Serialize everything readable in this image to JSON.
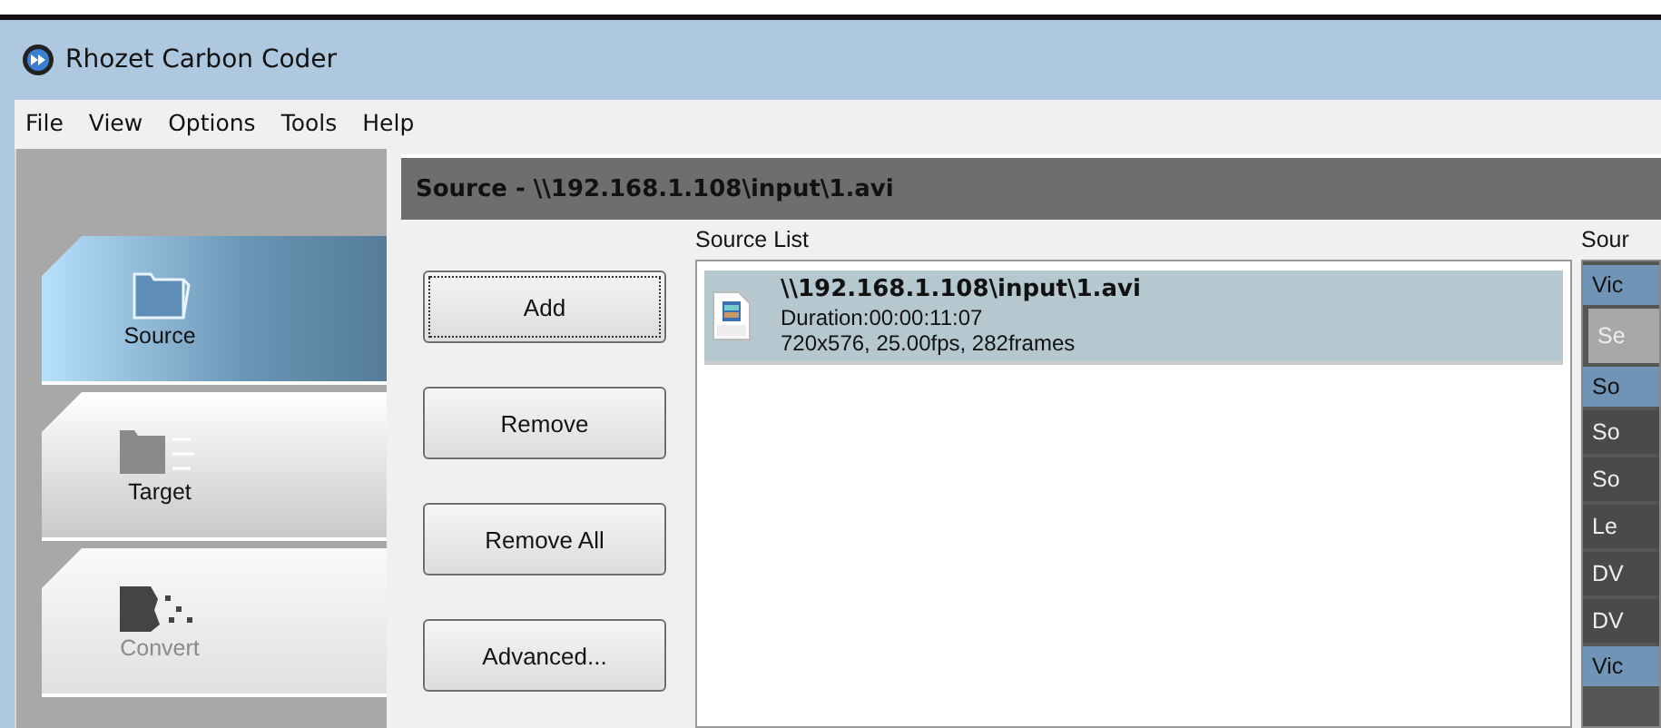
{
  "window": {
    "title": "Rhozet Carbon Coder"
  },
  "menu": [
    {
      "label": "File"
    },
    {
      "label": "View"
    },
    {
      "label": "Options"
    },
    {
      "label": "Tools"
    },
    {
      "label": "Help"
    }
  ],
  "sidebar": {
    "items": [
      {
        "label": "Source",
        "selected": true,
        "disabled": false,
        "kind": "source"
      },
      {
        "label": "Target",
        "selected": false,
        "disabled": false,
        "kind": "target"
      },
      {
        "label": "Convert",
        "selected": false,
        "disabled": true,
        "kind": "convert"
      }
    ]
  },
  "header": "Source - \\\\192.168.1.108\\input\\1.avi",
  "buttons": [
    {
      "label": "Add",
      "focused": true
    },
    {
      "label": "Remove",
      "focused": false
    },
    {
      "label": "Remove All",
      "focused": false
    },
    {
      "label": "Advanced...",
      "focused": false
    }
  ],
  "source_list": {
    "label": "Source List",
    "items": [
      {
        "path": "\\\\192.168.1.108\\input\\1.avi",
        "duration": "Duration:00:00:11:07",
        "info": "720x576, 25.00fps, 282frames",
        "selected": true
      }
    ]
  },
  "right_panel": {
    "label": "Sour",
    "rows": [
      {
        "text": "Vic",
        "kind": "header"
      },
      {
        "text": "Se",
        "kind": "button"
      },
      {
        "text": "So",
        "kind": "header"
      },
      {
        "text": "So",
        "kind": "item"
      },
      {
        "text": "So",
        "kind": "item"
      },
      {
        "text": "Le",
        "kind": "item"
      },
      {
        "text": "DV",
        "kind": "item"
      },
      {
        "text": "DV",
        "kind": "item"
      },
      {
        "text": "Vic",
        "kind": "header"
      }
    ]
  }
}
